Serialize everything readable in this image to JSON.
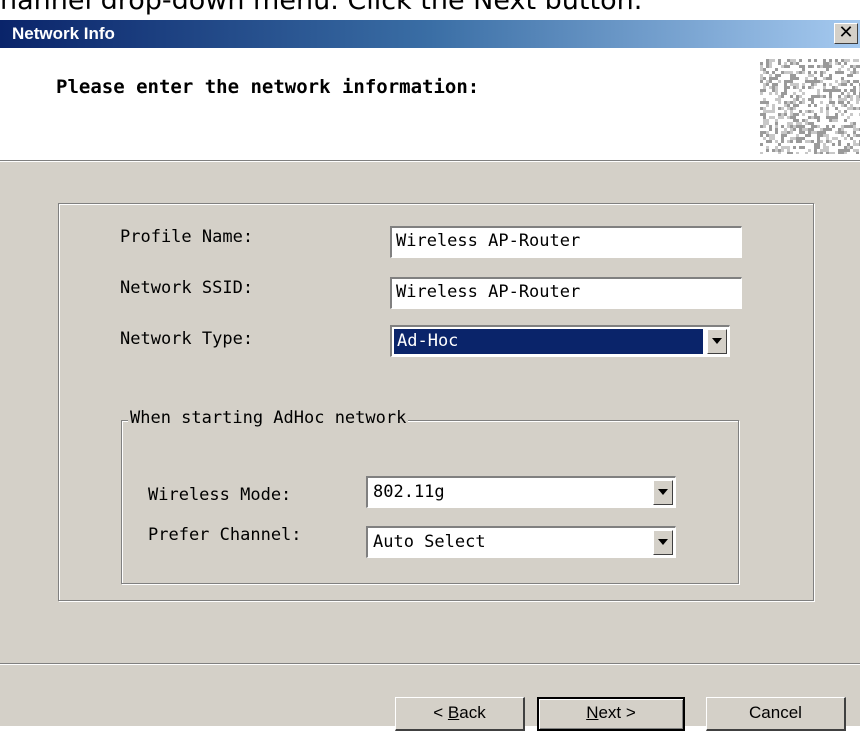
{
  "caption": "hannel drop-down menu. Click the Next button.",
  "window": {
    "title": "Network Info",
    "close_glyph": "✕"
  },
  "header": {
    "instruction": "Please enter the network information:"
  },
  "form": {
    "profile_name_label": "Profile Name:",
    "profile_name_value": "Wireless AP-Router",
    "network_ssid_label": "Network SSID:",
    "network_ssid_value": "Wireless AP-Router",
    "network_type_label": "Network Type:",
    "network_type_value": "Ad-Hoc"
  },
  "adhoc": {
    "group_label": "When starting AdHoc network",
    "wireless_mode_label": "Wireless Mode:",
    "wireless_mode_value": "802.11g",
    "prefer_channel_label": "Prefer Channel:",
    "prefer_channel_value": "Auto Select"
  },
  "buttons": {
    "back_prefix": "< ",
    "back_mnemonic": "B",
    "back_rest": "ack",
    "next_mnemonic": "N",
    "next_rest": "ext >",
    "cancel": "Cancel"
  },
  "colors": {
    "titlebar_start": "#0a246a",
    "titlebar_end": "#a6caf0",
    "dialog_face": "#d4d0c8",
    "selection": "#0a246a"
  }
}
